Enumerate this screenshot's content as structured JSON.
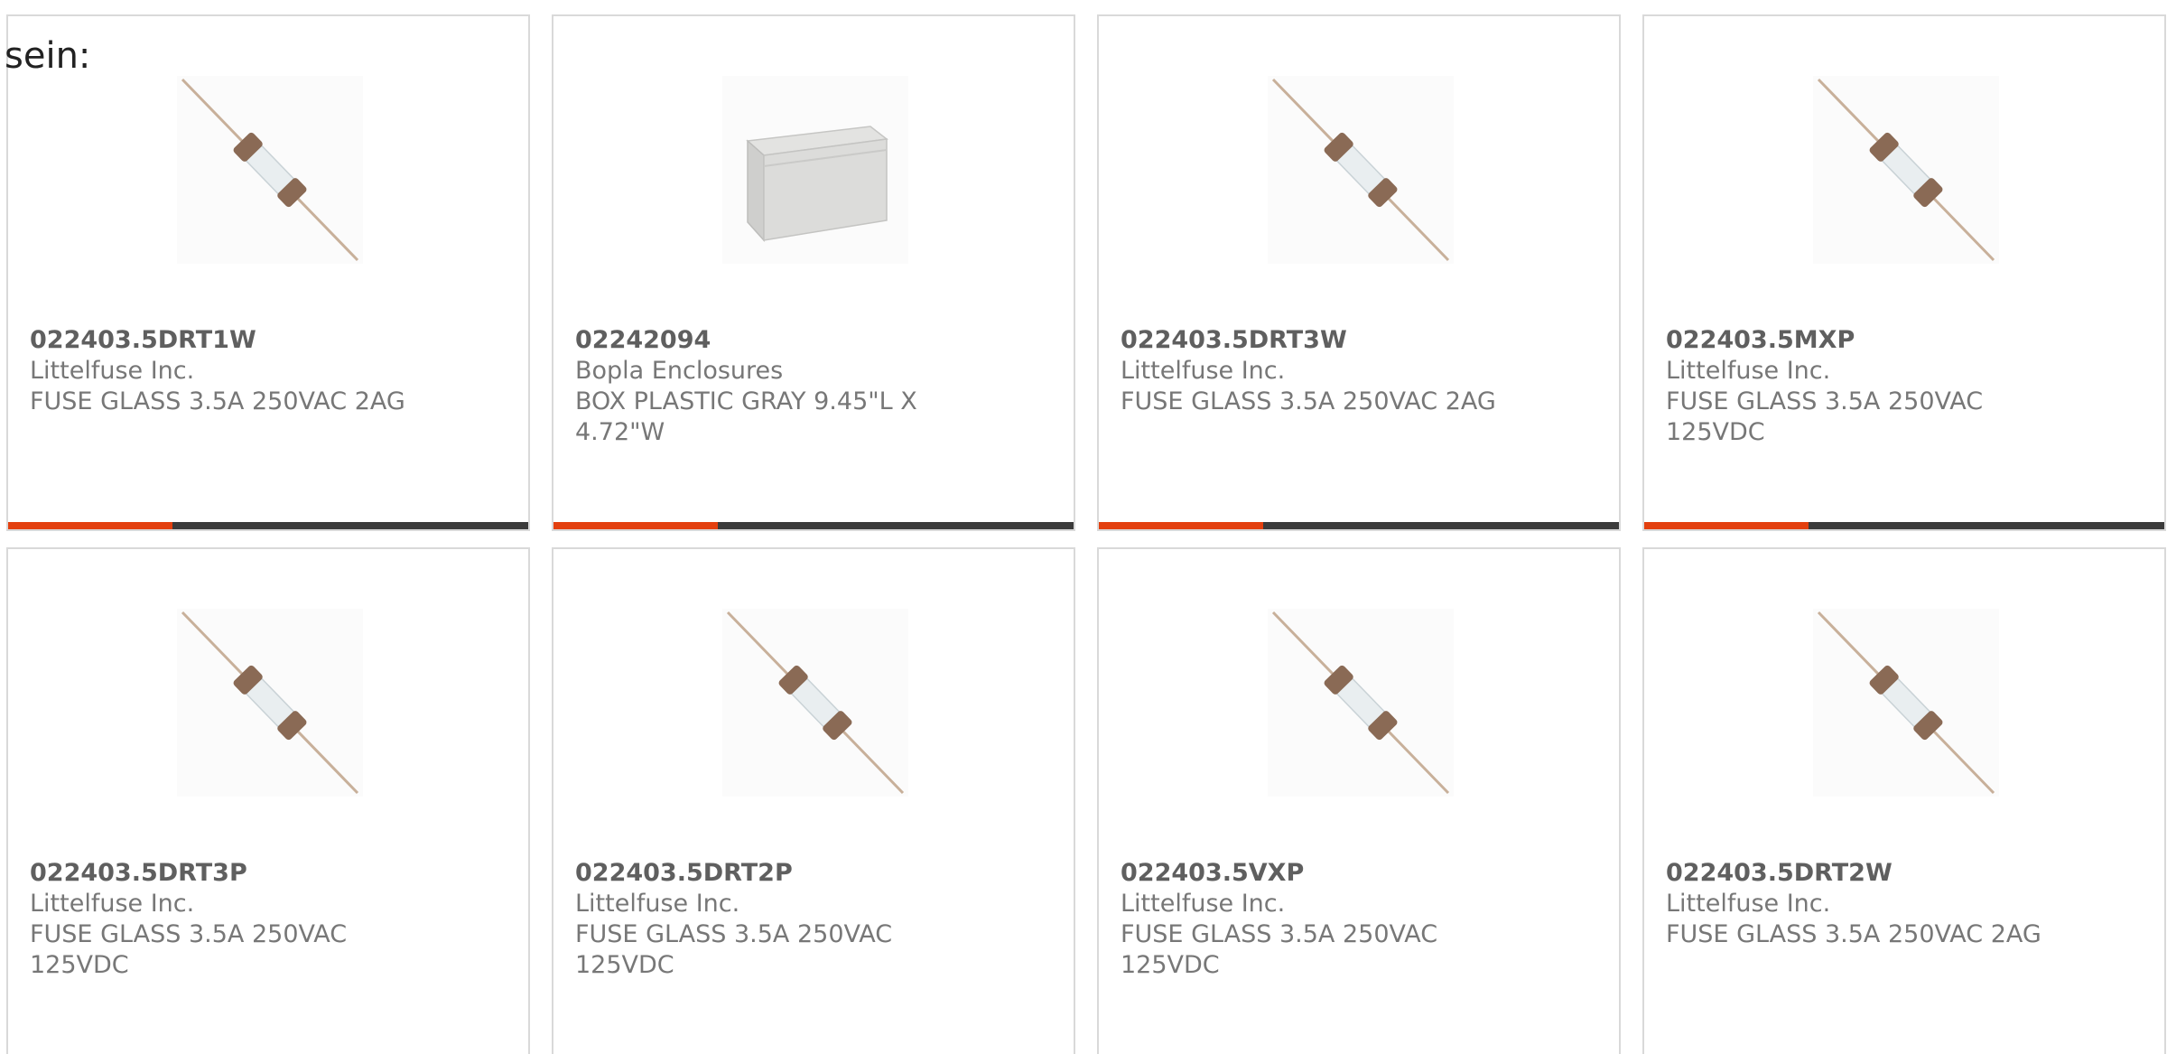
{
  "intro": {
    "text": "sein:"
  },
  "colors": {
    "accent": "#e3400f",
    "bar_dark": "#3b3b3b",
    "card_border": "#d9d9d9",
    "text_gray": "#777777"
  },
  "products": [
    {
      "part_number": "022403.5DRT1W",
      "manufacturer": "Littelfuse Inc.",
      "description": "FUSE GLASS 3.5A 250VAC 2AG",
      "image": "glass-fuse-icon"
    },
    {
      "part_number": "02242094",
      "manufacturer": "Bopla Enclosures",
      "description": "BOX PLASTIC GRAY 9.45\"L X 4.72\"W",
      "image": "plastic-box-icon"
    },
    {
      "part_number": "022403.5DRT3W",
      "manufacturer": "Littelfuse Inc.",
      "description": "FUSE GLASS 3.5A 250VAC 2AG",
      "image": "glass-fuse-icon"
    },
    {
      "part_number": "022403.5MXP",
      "manufacturer": "Littelfuse Inc.",
      "description": "FUSE GLASS 3.5A 250VAC 125VDC",
      "image": "glass-fuse-icon"
    },
    {
      "part_number": "022403.5DRT3P",
      "manufacturer": "Littelfuse Inc.",
      "description": "FUSE GLASS 3.5A 250VAC 125VDC",
      "image": "glass-fuse-icon"
    },
    {
      "part_number": "022403.5DRT2P",
      "manufacturer": "Littelfuse Inc.",
      "description": "FUSE GLASS 3.5A 250VAC 125VDC",
      "image": "glass-fuse-icon"
    },
    {
      "part_number": "022403.5VXP",
      "manufacturer": "Littelfuse Inc.",
      "description": "FUSE GLASS 3.5A 250VAC 125VDC",
      "image": "glass-fuse-icon"
    },
    {
      "part_number": "022403.5DRT2W",
      "manufacturer": "Littelfuse Inc.",
      "description": "FUSE GLASS 3.5A 250VAC 2AG",
      "image": "glass-fuse-icon"
    }
  ]
}
